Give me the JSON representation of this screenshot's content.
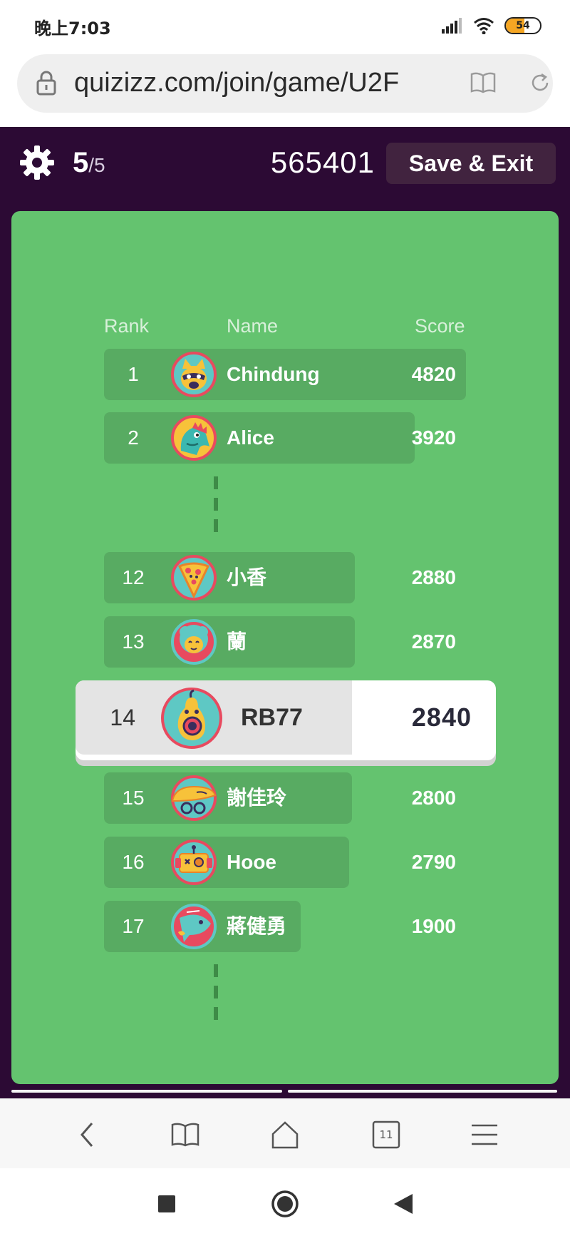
{
  "status_bar": {
    "time": "晚上7:03",
    "battery_level": "54",
    "battery_fraction": 0.54,
    "icons": [
      "signal-icon",
      "wifi-icon",
      "battery-icon"
    ]
  },
  "browser": {
    "url": "quizizz.com/join/game/U2F",
    "tab_count": "11"
  },
  "game_header": {
    "progress_current": "5",
    "progress_total": "/5",
    "game_code": "565401",
    "save_exit_label": "Save & Exit"
  },
  "leaderboard": {
    "headers": {
      "rank": "Rank",
      "name": "Name",
      "score": "Score"
    },
    "top_rows": [
      {
        "rank": "1",
        "name": "Chindung",
        "score": "4820",
        "avatar": "raccoon-avatar-icon"
      },
      {
        "rank": "2",
        "name": "Alice",
        "score": "3920",
        "avatar": "dinosaur-avatar-icon"
      }
    ],
    "middle_rows": [
      {
        "rank": "12",
        "name": "小香",
        "score": "2880",
        "avatar": "pizza-avatar-icon"
      },
      {
        "rank": "13",
        "name": "蘭",
        "score": "2870",
        "avatar": "lion-avatar-icon"
      }
    ],
    "me": {
      "rank": "14",
      "name": "RB77",
      "score": "2840",
      "avatar": "pear-avatar-icon"
    },
    "bottom_rows": [
      {
        "rank": "15",
        "name": "謝佳玲",
        "score": "2800",
        "avatar": "taco-avatar-icon"
      },
      {
        "rank": "16",
        "name": "Hooe",
        "score": "2790",
        "avatar": "robot-avatar-icon"
      },
      {
        "rank": "17",
        "name": "蔣健勇",
        "score": "1900",
        "avatar": "fish-avatar-icon"
      }
    ]
  },
  "colors": {
    "board_green": "#64c36f",
    "row_green": "#58ab62",
    "header_purple": "#2c0a34",
    "save_button": "#41233f"
  }
}
